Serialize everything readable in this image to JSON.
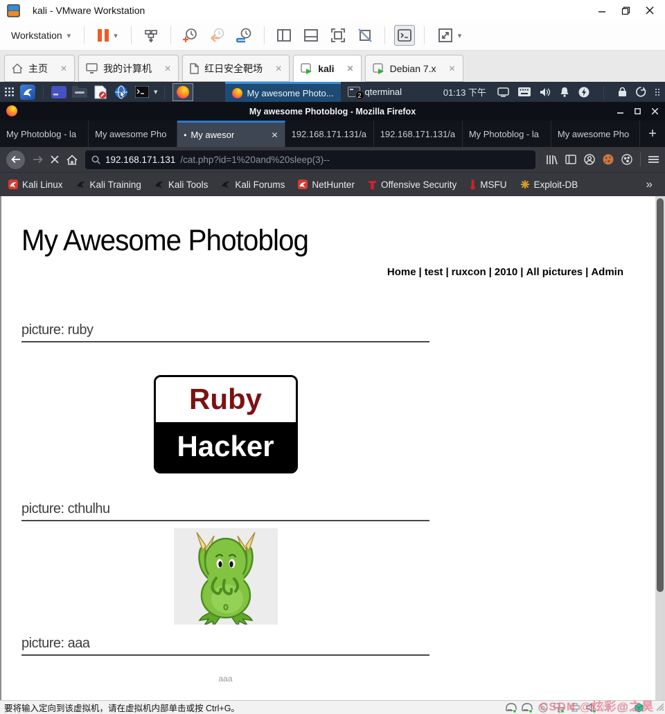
{
  "glyphs": {
    "close": "✕",
    "new_tab": "+",
    "caret": "▾",
    "overflow": "»",
    "tab_dot": "•"
  },
  "vmware": {
    "window_title": "kali - VMware Workstation",
    "menu": {
      "workstation_label": "Workstation"
    },
    "tabs": [
      {
        "label": "主页"
      },
      {
        "label": "我的计算机"
      },
      {
        "label": "红日安全靶场"
      },
      {
        "label": "kali"
      },
      {
        "label": "Debian 7.x"
      }
    ],
    "statusbar": {
      "message": "要将输入定向到该虚拟机，请在虚拟机内部单击或按 Ctrl+G。"
    },
    "watermark": "CSDN @炫彩@之昊"
  },
  "kali_desktop": {
    "taskbar": {
      "window_buttons": [
        {
          "label": "My awesome Photo..."
        },
        {
          "label": "qterminal",
          "badge": "2"
        }
      ],
      "clock": "01:13 下午"
    }
  },
  "firefox": {
    "window_title": "My awesome Photoblog - Mozilla Firefox",
    "tabs": [
      {
        "label": "My Photoblog - la"
      },
      {
        "label": "My awesome Pho"
      },
      {
        "label": "My awesor"
      },
      {
        "label": "192.168.171.131/a"
      },
      {
        "label": "192.168.171.131/a"
      },
      {
        "label": "My Photoblog - la"
      },
      {
        "label": "My awesome Pho"
      }
    ],
    "urlbar": {
      "host": "192.168.171.131",
      "path": "/cat.php?id=1%20and%20sleep(3)--"
    },
    "bookmarks": [
      {
        "label": "Kali Linux"
      },
      {
        "label": "Kali Training"
      },
      {
        "label": "Kali Tools"
      },
      {
        "label": "Kali Forums"
      },
      {
        "label": "NetHunter"
      },
      {
        "label": "Offensive Security"
      },
      {
        "label": "MSFU"
      },
      {
        "label": "Exploit-DB"
      }
    ]
  },
  "page": {
    "title": "My Awesome Photoblog",
    "nav": {
      "separator": "|",
      "links": [
        "Home",
        "test",
        "ruxcon",
        "2010",
        "All pictures",
        "Admin"
      ]
    },
    "sections": [
      {
        "heading": "picture: ruby"
      },
      {
        "heading": "picture: cthulhu"
      },
      {
        "heading": "picture: aaa",
        "caption": "aaa"
      }
    ],
    "ruby_badge": {
      "top_text": "Ruby",
      "bottom_text": "Hacker"
    }
  }
}
